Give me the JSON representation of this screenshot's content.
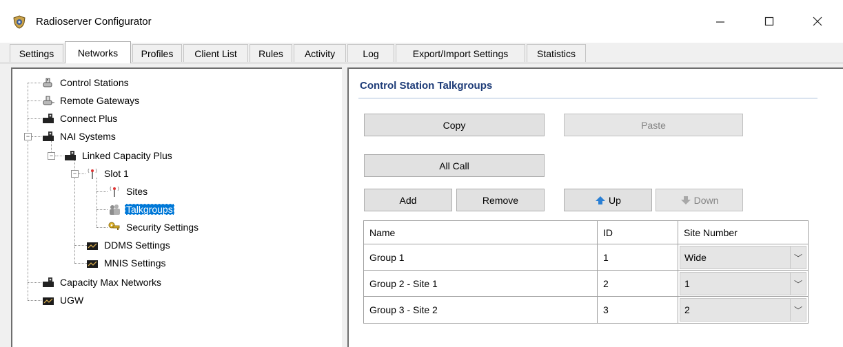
{
  "window": {
    "title": "Radioserver Configurator",
    "controls": {
      "minimize": "—",
      "maximize": "☐",
      "close": "✕"
    }
  },
  "tabs": [
    {
      "label": "Settings",
      "active": false
    },
    {
      "label": "Networks",
      "active": true
    },
    {
      "label": "Profiles",
      "active": false
    },
    {
      "label": "Client List",
      "active": false
    },
    {
      "label": "Rules",
      "active": false
    },
    {
      "label": "Activity",
      "active": false
    },
    {
      "label": "Log",
      "active": false
    },
    {
      "label": "Export/Import Settings",
      "active": false
    },
    {
      "label": "Statistics",
      "active": false
    }
  ],
  "tree": {
    "items": [
      {
        "label": "Control Stations",
        "icon": "control-station-icon"
      },
      {
        "label": "Remote Gateways",
        "icon": "gateway-icon"
      },
      {
        "label": "Connect Plus",
        "icon": "repeater-icon"
      },
      {
        "label": "NAI Systems",
        "icon": "repeater-icon",
        "expander": "−"
      },
      {
        "label": "Linked Capacity Plus",
        "icon": "repeater-icon",
        "expander": "−"
      },
      {
        "label": "Slot 1",
        "icon": "antenna-icon",
        "expander": "−"
      },
      {
        "label": "Sites",
        "icon": "antenna-icon"
      },
      {
        "label": "Talkgroups",
        "icon": "talkgroups-icon",
        "selected": true
      },
      {
        "label": "Security Settings",
        "icon": "keys-icon"
      },
      {
        "label": "DDMS Settings",
        "icon": "monitor-icon"
      },
      {
        "label": "MNIS Settings",
        "icon": "monitor-icon"
      },
      {
        "label": "Capacity Max Networks",
        "icon": "repeater-icon"
      },
      {
        "label": "UGW",
        "icon": "monitor-icon"
      }
    ]
  },
  "panel": {
    "title": "Control Station Talkgroups",
    "buttons": {
      "copy": "Copy",
      "paste": "Paste",
      "all_call": "All Call",
      "add": "Add",
      "remove": "Remove",
      "up": "Up",
      "down": "Down"
    },
    "grid": {
      "columns": [
        "Name",
        "ID",
        "Site Number"
      ],
      "rows": [
        {
          "name": "Group 1",
          "id": "1",
          "site": "Wide"
        },
        {
          "name": "Group 2 - Site 1",
          "id": "2",
          "site": "1"
        },
        {
          "name": "Group 3 - Site 2",
          "id": "3",
          "site": "2"
        }
      ]
    }
  },
  "colors": {
    "selection": "#0078d7",
    "panel_title": "#1e3c78",
    "window_bg": "#f0f0f0"
  }
}
